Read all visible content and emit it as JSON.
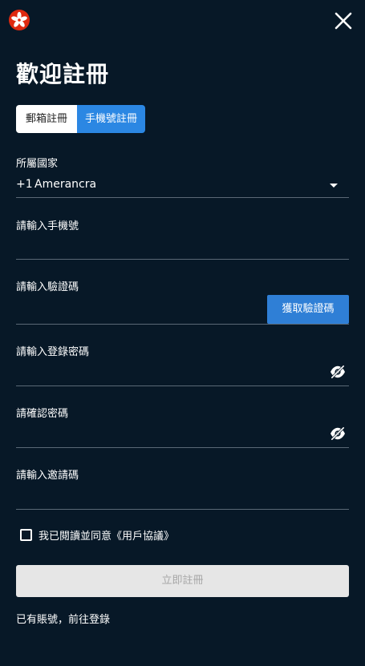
{
  "header": {
    "title": "歡迎註冊"
  },
  "tabs": [
    {
      "label": "郵箱註冊",
      "active": false
    },
    {
      "label": "手機號註冊",
      "active": true
    }
  ],
  "country": {
    "label": "所屬國家",
    "code": "+1",
    "name": "Amerancra"
  },
  "phone": {
    "label": "請輸入手機號",
    "value": ""
  },
  "verify": {
    "label": "請輸入驗證碼",
    "value": "",
    "button": "獲取驗證碼"
  },
  "password": {
    "label": "請輸入登錄密碼",
    "value": ""
  },
  "confirm": {
    "label": "請確認密碼",
    "value": ""
  },
  "invite": {
    "label": "請輸入邀請碼",
    "value": ""
  },
  "agreement": {
    "text": "我已閱讀並同意《用戶協議》",
    "checked": false
  },
  "submit": {
    "label": "立即註冊"
  },
  "login": {
    "text": "已有賬號，前往登錄"
  },
  "colors": {
    "background": "#071827",
    "accent": "#2b87e3",
    "disabled": "#e6e6e6"
  },
  "icons": [
    "hong-kong-flag-logo",
    "close-icon",
    "caret-down-icon",
    "eye-off-icon",
    "checkbox-icon"
  ]
}
